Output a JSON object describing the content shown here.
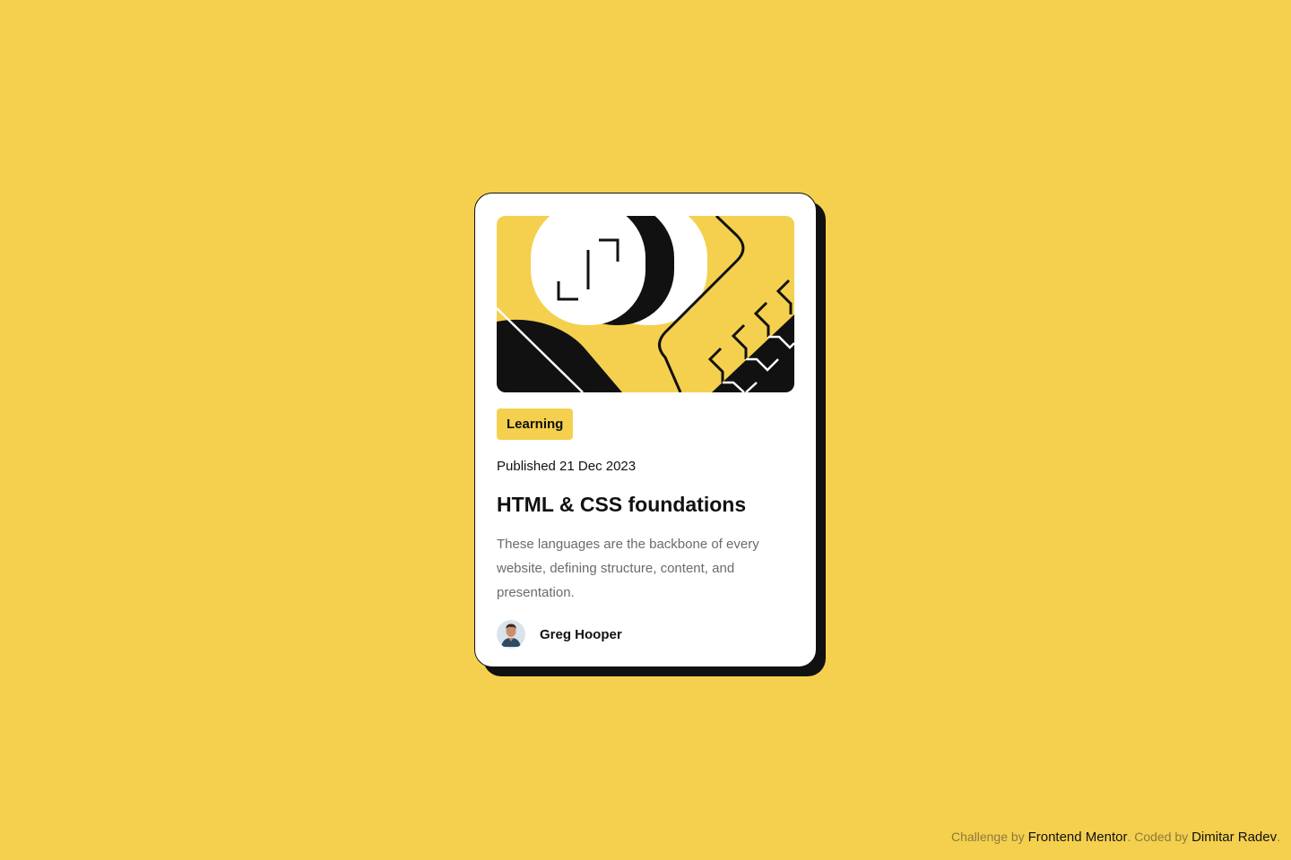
{
  "card": {
    "tag": "Learning",
    "published": "Published 21 Dec 2023",
    "title": "HTML & CSS foundations",
    "description": "These languages are the backbone of every website, defining structure, content, and presentation.",
    "author": "Greg Hooper"
  },
  "attribution": {
    "prefix": "Challenge by ",
    "challenge_link": "Frontend Mentor",
    "middle": ". Coded by ",
    "author_link": "Dimitar Radev",
    "suffix": "."
  },
  "colors": {
    "background": "#F4D04E",
    "ink": "#111111",
    "card": "#FFFFFF",
    "muted": "#6B6B6B"
  }
}
